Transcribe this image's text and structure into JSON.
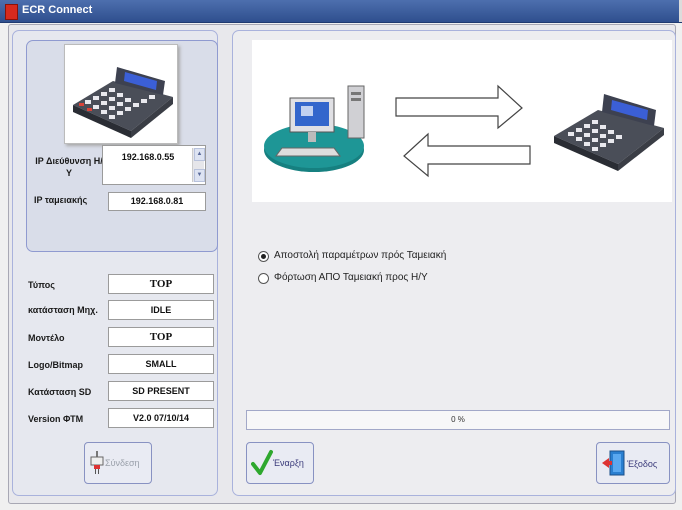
{
  "window": {
    "title": "ECR Connect"
  },
  "connection": {
    "pc_ip_label": "IP Διεύθυνση Η/Υ",
    "pc_ip_value": "192.168.0.55",
    "register_ip_label": "IP ταμειακής",
    "register_ip_value": "192.168.0.81"
  },
  "device_info": [
    {
      "label": "Τύπος",
      "value": "TOP"
    },
    {
      "label": "κατάσταση Μηχ.",
      "value": "IDLE"
    },
    {
      "label": "Μοντέλο",
      "value": "TOP"
    },
    {
      "label": "Logo/Bitmap",
      "value": "SMALL"
    },
    {
      "label": "Κατάσταση SD",
      "value": "SD PRESENT"
    },
    {
      "label": "Version ΦΤΜ",
      "value": "V2.0  07/10/14"
    }
  ],
  "buttons": {
    "connect": "Σύνδεση",
    "start": "Έναρξη",
    "exit": "Έξοδος"
  },
  "options": [
    {
      "label": "Αποστολή  παραμέτρων πρός Ταμειακή",
      "selected": true
    },
    {
      "label": "Φόρτωση ΑΠΟ Ταμειακή προς Η/Υ",
      "selected": false
    }
  ],
  "progress": {
    "value": 0,
    "label": "0 %"
  },
  "colors": {
    "titlebar": "#2f4f8e",
    "panel_border": "#a9b2dc",
    "progress_fill": "#5fa0e0",
    "start_check": "#2ea82e",
    "exit_door": "#2a7fd0"
  }
}
